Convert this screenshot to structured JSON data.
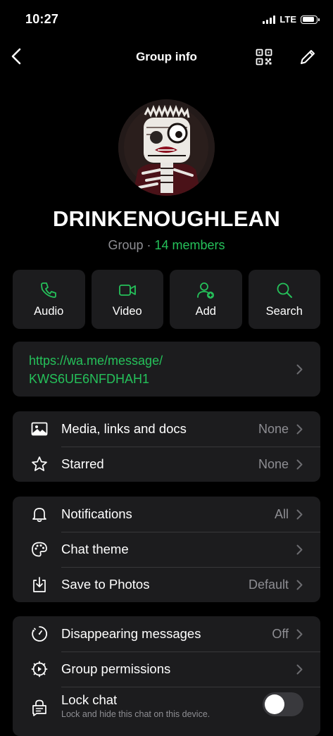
{
  "status_bar": {
    "time": "10:27",
    "network": "LTE"
  },
  "nav": {
    "title": "Group info",
    "back_icon": "chevron-left-icon",
    "qr_icon": "qr-code-icon",
    "edit_icon": "pencil-icon"
  },
  "group": {
    "name": "DRINKENOUGHLEAN",
    "type": "Group",
    "separator": " · ",
    "members": "14 members"
  },
  "actions": [
    {
      "label": "Audio",
      "icon": "phone-icon"
    },
    {
      "label": "Video",
      "icon": "video-camera-icon"
    },
    {
      "label": "Add",
      "icon": "add-person-icon"
    },
    {
      "label": "Search",
      "icon": "search-icon"
    }
  ],
  "invite_link": {
    "line1": "https://wa.me/message/",
    "line2": "KWS6UE6NFDHAH1"
  },
  "section_media": [
    {
      "label": "Media, links and docs",
      "value": "None",
      "icon": "image-icon"
    },
    {
      "label": "Starred",
      "value": "None",
      "icon": "star-icon"
    }
  ],
  "section_settings": [
    {
      "label": "Notifications",
      "value": "All",
      "icon": "bell-icon"
    },
    {
      "label": "Chat theme",
      "value": "",
      "icon": "palette-icon"
    },
    {
      "label": "Save to Photos",
      "value": "Default",
      "icon": "download-icon"
    }
  ],
  "section_privacy": [
    {
      "label": "Disappearing messages",
      "value": "Off",
      "icon": "timer-icon"
    },
    {
      "label": "Group permissions",
      "value": "",
      "icon": "gear-icon"
    },
    {
      "label": "Lock chat",
      "sublabel": "Lock and hide this chat on this device.",
      "icon": "lock-chat-icon",
      "toggle_on": false
    }
  ],
  "colors": {
    "accent": "#25c15a",
    "card": "#1c1c1e",
    "secondary_text": "#8e8e93",
    "background": "#000000"
  }
}
